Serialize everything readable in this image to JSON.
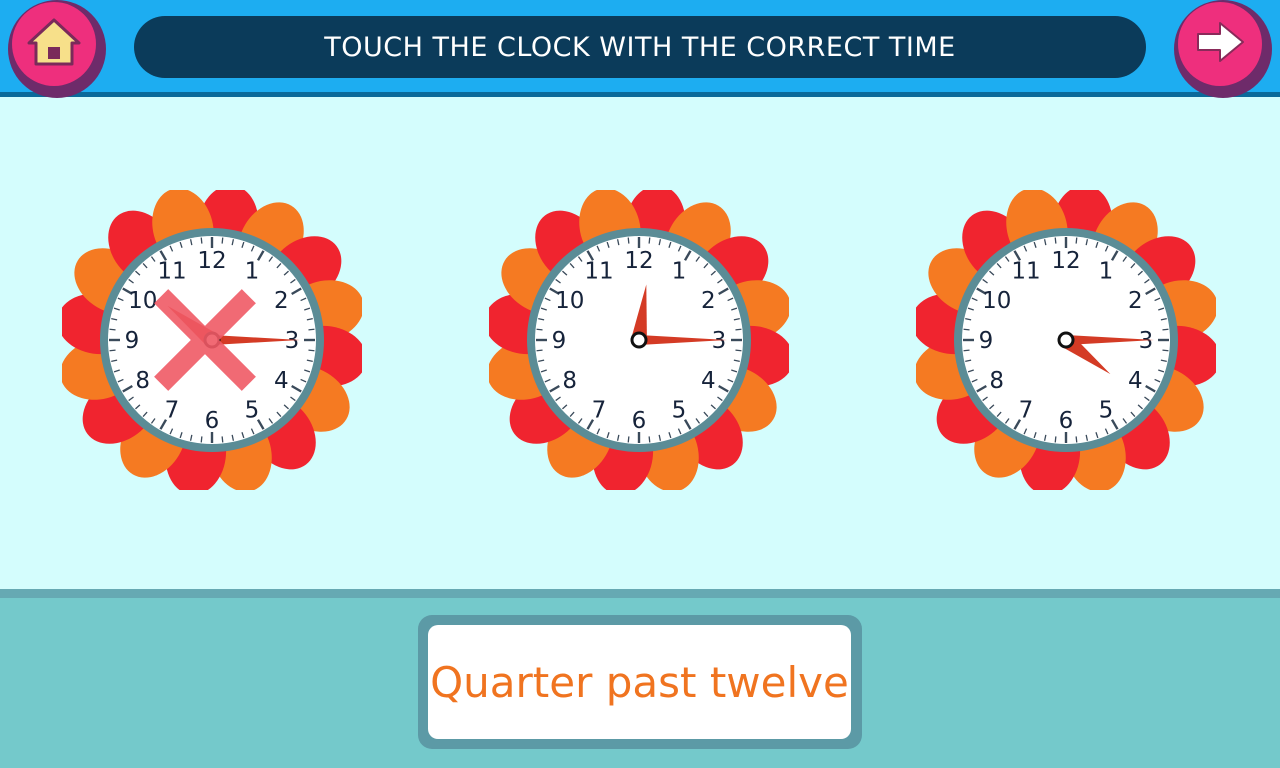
{
  "header": {
    "instruction": "TOUCH THE CLOCK WITH THE CORRECT TIME",
    "home_icon": "home-icon",
    "next_icon": "arrow-right-icon"
  },
  "clocks": [
    {
      "hour": 10,
      "minute": 15,
      "state": "wrong"
    },
    {
      "hour": 12,
      "minute": 15,
      "state": "neutral"
    },
    {
      "hour": 4,
      "minute": 15,
      "state": "neutral"
    }
  ],
  "numerals": [
    "12",
    "1",
    "2",
    "3",
    "4",
    "5",
    "6",
    "7",
    "8",
    "9",
    "10",
    "11"
  ],
  "answer": {
    "label": "Quarter past twelve"
  },
  "colors": {
    "header_bg": "#1dadf1",
    "title_pill": "#0b3b5a",
    "button_pink": "#ee2f7d",
    "play_bg": "#d4fdfd",
    "bottom_bg": "#74c9cb",
    "answer_text": "#f07420",
    "clock_hand": "#d43b25",
    "wrong_mark": "#f05a66"
  }
}
